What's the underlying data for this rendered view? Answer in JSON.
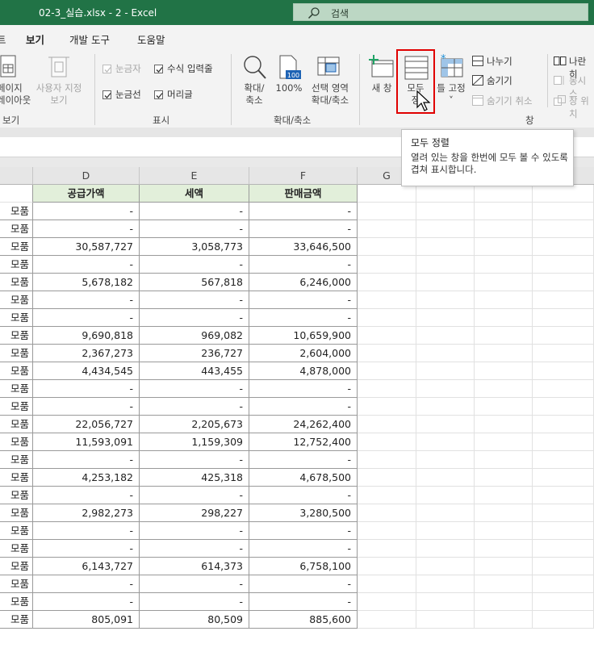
{
  "titlebar": {
    "title": "02-3_실습.xlsx  -  2  -  Excel",
    "search_placeholder": "검색"
  },
  "tabs": [
    {
      "label": "트",
      "active": false
    },
    {
      "label": "보기",
      "active": true
    },
    {
      "label": "개발 도구",
      "active": false
    },
    {
      "label": "도움말",
      "active": false
    }
  ],
  "ribbon": {
    "workbook_views": {
      "page_layout_1": "페이지",
      "page_layout_2": "레이아웃",
      "custom_views_1": "사용자 지정",
      "custom_views_2": "보기",
      "group": "보기"
    },
    "show": {
      "ruler": "눈금자",
      "formula_bar": "수식 입력줄",
      "gridlines": "눈금선",
      "headings": "머리글",
      "group": "표시"
    },
    "zoom": {
      "zoom_1": "확대/",
      "zoom_2": "축소",
      "zoom100": "100%",
      "zoom100_icon_text": "100",
      "zoom_sel_1": "선택 영역",
      "zoom_sel_2": "확대/축소",
      "group": "확대/축소"
    },
    "window": {
      "new_window": "새 창",
      "arrange_all_1": "모두",
      "arrange_all_2": "정",
      "freeze_1": "틀 고정",
      "freeze_2": "˅",
      "split": "나누기",
      "hide": "숨기기",
      "unhide": "숨기기 취소",
      "side_by_side": "나란히",
      "sync_scroll": "동시 스",
      "reset_position": "창 위치",
      "group": "창"
    }
  },
  "tooltip": {
    "title": "모두 정렬",
    "description": "열려 있는 창을 한번에 모두 볼 수 있도록 겹쳐 표시합니다."
  },
  "sheet": {
    "columns": [
      "D",
      "E",
      "F",
      "G"
    ],
    "header_row": {
      "c": "",
      "d": "공급가액",
      "e": "세액",
      "f": "판매금액"
    },
    "rows": [
      {
        "c": "모품",
        "d": "-",
        "e": "-",
        "f": "-"
      },
      {
        "c": "모품",
        "d": "-",
        "e": "-",
        "f": "-"
      },
      {
        "c": "모품",
        "d": "30,587,727",
        "e": "3,058,773",
        "f": "33,646,500"
      },
      {
        "c": "모품",
        "d": "-",
        "e": "-",
        "f": "-"
      },
      {
        "c": "모품",
        "d": "5,678,182",
        "e": "567,818",
        "f": "6,246,000"
      },
      {
        "c": "모품",
        "d": "-",
        "e": "-",
        "f": "-"
      },
      {
        "c": "모품",
        "d": "-",
        "e": "-",
        "f": "-"
      },
      {
        "c": "모품",
        "d": "9,690,818",
        "e": "969,082",
        "f": "10,659,900"
      },
      {
        "c": "모품",
        "d": "2,367,273",
        "e": "236,727",
        "f": "2,604,000"
      },
      {
        "c": "모품",
        "d": "4,434,545",
        "e": "443,455",
        "f": "4,878,000"
      },
      {
        "c": "모품",
        "d": "-",
        "e": "-",
        "f": "-"
      },
      {
        "c": "모품",
        "d": "-",
        "e": "-",
        "f": "-"
      },
      {
        "c": "모품",
        "d": "22,056,727",
        "e": "2,205,673",
        "f": "24,262,400"
      },
      {
        "c": "모품",
        "d": "11,593,091",
        "e": "1,159,309",
        "f": "12,752,400"
      },
      {
        "c": "모품",
        "d": "-",
        "e": "-",
        "f": "-"
      },
      {
        "c": "모품",
        "d": "4,253,182",
        "e": "425,318",
        "f": "4,678,500"
      },
      {
        "c": "모품",
        "d": "-",
        "e": "-",
        "f": "-"
      },
      {
        "c": "모품",
        "d": "2,982,273",
        "e": "298,227",
        "f": "3,280,500"
      },
      {
        "c": "모품",
        "d": "-",
        "e": "-",
        "f": "-"
      },
      {
        "c": "모품",
        "d": "-",
        "e": "-",
        "f": "-"
      },
      {
        "c": "모품",
        "d": "6,143,727",
        "e": "614,373",
        "f": "6,758,100"
      },
      {
        "c": "모품",
        "d": "-",
        "e": "-",
        "f": "-"
      },
      {
        "c": "모품",
        "d": "-",
        "e": "-",
        "f": "-"
      },
      {
        "c": "모품",
        "d": "805,091",
        "e": "80,509",
        "f": "885,600"
      }
    ]
  },
  "colors": {
    "excel_green": "#217346",
    "header_fill": "#e2efda",
    "highlight": "#e00000"
  }
}
